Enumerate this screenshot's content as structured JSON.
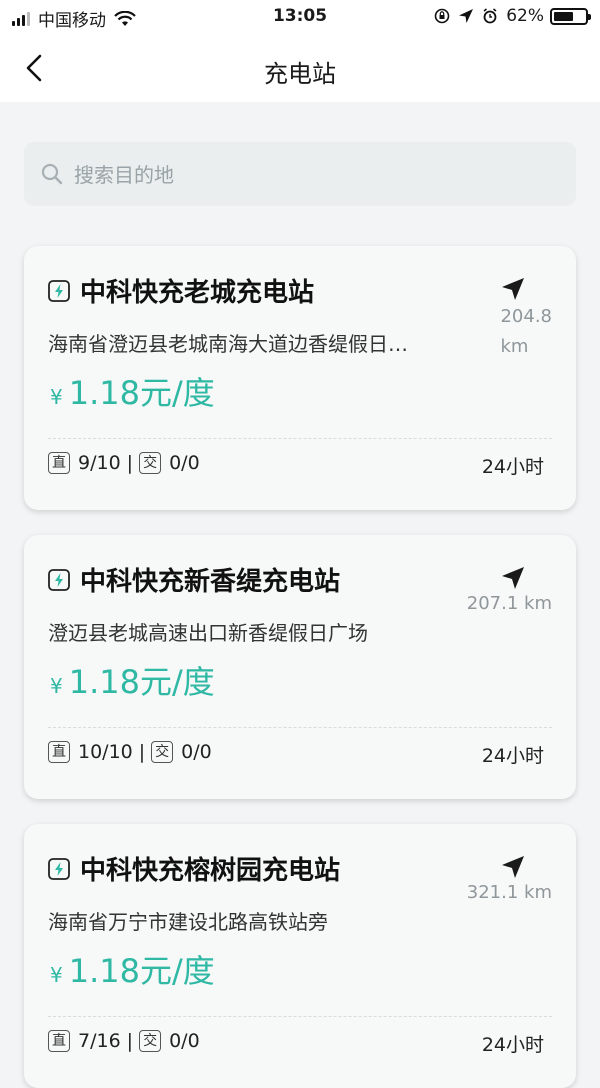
{
  "status_bar": {
    "carrier": "中国移动",
    "time": "13:05",
    "battery": "62%",
    "battery_level": 0.62
  },
  "nav": {
    "title": "充电站"
  },
  "search": {
    "placeholder": "搜索目的地"
  },
  "stations": [
    {
      "name": "中科快充老城充电站",
      "address": "海南省澄迈县老城南海大道边香缇假日…",
      "price_symbol": "¥",
      "price": "1.18元/度",
      "distance_value": "204.8",
      "distance_unit": "km",
      "dc_label": "直",
      "dc": "9/10",
      "ac_label": "交",
      "ac": "0/0",
      "hours": "24小时"
    },
    {
      "name": "中科快充新香缇充电站",
      "address": "澄迈县老城高速出口新香缇假日广场",
      "price_symbol": "¥",
      "price": "1.18元/度",
      "distance": "207.1 km",
      "dc_label": "直",
      "dc": "10/10",
      "ac_label": "交",
      "ac": "0/0",
      "hours": "24小时"
    },
    {
      "name": "中科快充榕树园充电站",
      "address": "海南省万宁市建设北路高铁站旁",
      "price_symbol": "¥",
      "price": "1.18元/度",
      "distance": "321.1 km",
      "dc_label": "直",
      "dc": "7/16",
      "ac_label": "交",
      "ac": "0/0",
      "hours": "24小时"
    }
  ],
  "colors": {
    "accent": "#2fb8a4",
    "background": "#f2f4f5",
    "card": "#f7f8f8"
  }
}
